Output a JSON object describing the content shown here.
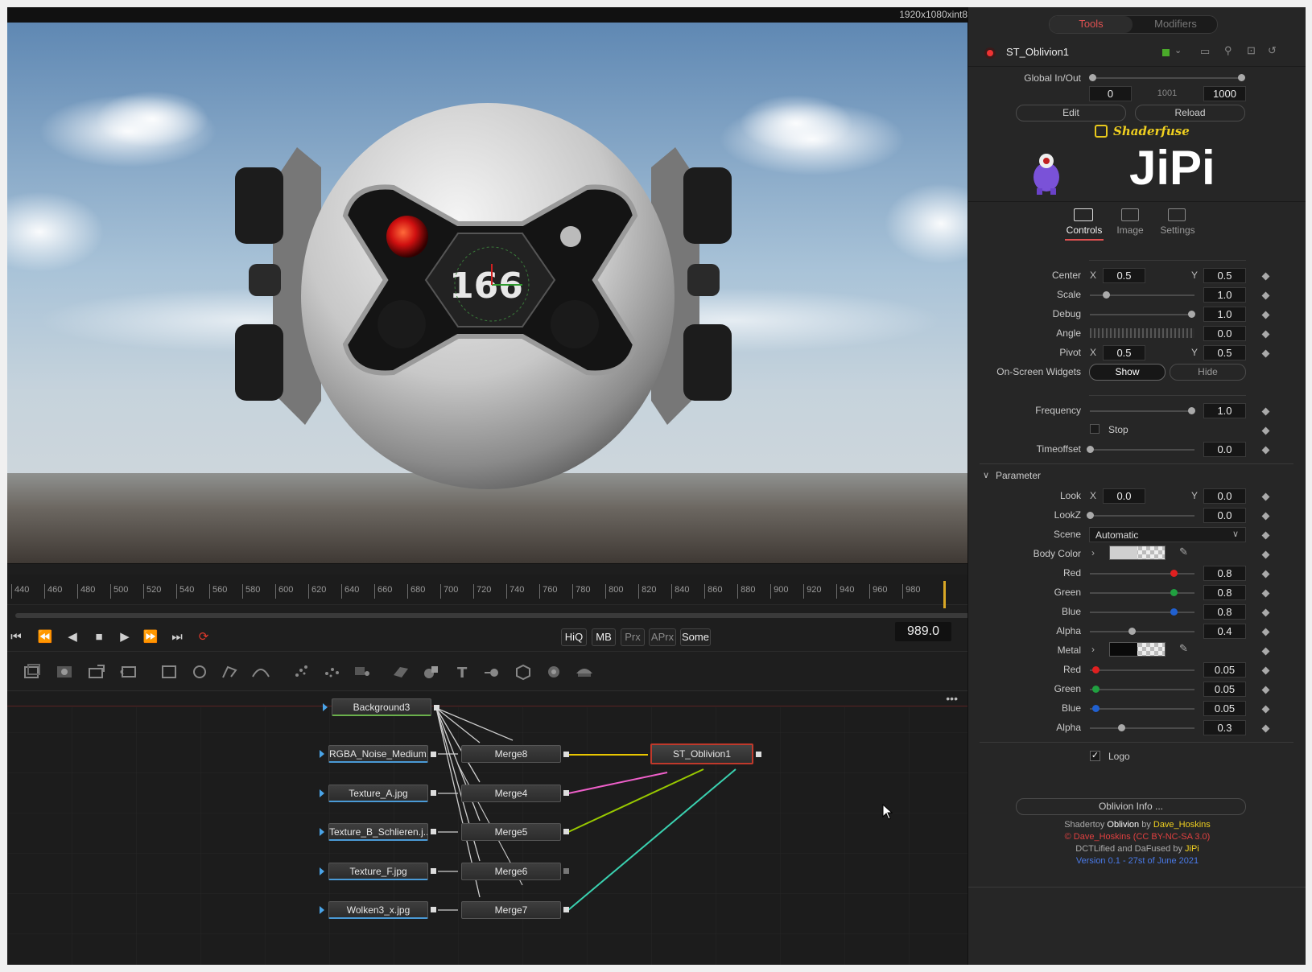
{
  "viewer": {
    "resolution_label": "1920x1080xint8"
  },
  "timeline": {
    "ticks": [
      "440",
      "460",
      "480",
      "500",
      "520",
      "540",
      "560",
      "580",
      "600",
      "620",
      "640",
      "660",
      "680",
      "700",
      "720",
      "740",
      "760",
      "780",
      "800",
      "820",
      "840",
      "860",
      "880",
      "900",
      "920",
      "940",
      "960",
      "980"
    ],
    "current_frame": "989.0"
  },
  "transport": {
    "quality_buttons": [
      "HiQ",
      "MB",
      "Prx",
      "APrx",
      "Some"
    ]
  },
  "flow": {
    "nodes": {
      "background": "Background3",
      "noise": "RGBA_Noise_Medium...",
      "tex_a": "Texture_A.jpg",
      "tex_b": "Texture_B_Schlieren.j...",
      "tex_f": "Texture_F.jpg",
      "wolken": "Wolken3_x.jpg",
      "merge8": "Merge8",
      "merge4": "Merge4",
      "merge5": "Merge5",
      "merge6": "Merge6",
      "merge7": "Merge7",
      "fuse": "ST_Oblivion1"
    },
    "more": "•••"
  },
  "inspector": {
    "tabs": {
      "tools": "Tools",
      "modifiers": "Modifiers"
    },
    "tool_name": "ST_Oblivion1",
    "global_inout_label": "Global In/Out",
    "global_in": "0",
    "global_mid": "1001",
    "global_out": "1000",
    "edit_label": "Edit",
    "reload_label": "Reload",
    "shaderfuse_label": "Shaderfuse",
    "jipi_label": "JiPi",
    "subtabs": {
      "controls": "Controls",
      "image": "Image",
      "settings": "Settings"
    },
    "center": {
      "label": "Center",
      "x_label": "X",
      "x": "0.5",
      "y_label": "Y",
      "y": "0.5"
    },
    "scale": {
      "label": "Scale",
      "value": "1.0",
      "level": 0.15
    },
    "debug": {
      "label": "Debug",
      "value": "1.0",
      "level": 0.97
    },
    "angle": {
      "label": "Angle",
      "value": "0.0"
    },
    "pivot": {
      "label": "Pivot",
      "x_label": "X",
      "x": "0.5",
      "y_label": "Y",
      "y": "0.5"
    },
    "widgets": {
      "label": "On-Screen Widgets",
      "show": "Show",
      "hide": "Hide"
    },
    "frequency": {
      "label": "Frequency",
      "value": "1.0",
      "level": 0.97
    },
    "stop_label": "Stop",
    "timeoffset": {
      "label": "Timeoffset",
      "value": "0.0",
      "level": 0.0
    },
    "parameter_label": "Parameter",
    "look": {
      "label": "Look",
      "x_label": "X",
      "x": "0.0",
      "y_label": "Y",
      "y": "0.0"
    },
    "lookz": {
      "label": "LookZ",
      "value": "0.0",
      "level": 0.0
    },
    "scene": {
      "label": "Scene",
      "value": "Automatic"
    },
    "body_color": {
      "label": "Body Color",
      "red": {
        "label": "Red",
        "value": "0.8",
        "level": 0.8,
        "color": "#e02020"
      },
      "green": {
        "label": "Green",
        "value": "0.8",
        "level": 0.8,
        "color": "#20a040"
      },
      "blue": {
        "label": "Blue",
        "value": "0.8",
        "level": 0.8,
        "color": "#2060d0"
      },
      "alpha": {
        "label": "Alpha",
        "value": "0.4",
        "level": 0.4,
        "color": "#aaaaaa"
      }
    },
    "metal": {
      "label": "Metal",
      "red": {
        "label": "Red",
        "value": "0.05",
        "level": 0.05,
        "color": "#e02020"
      },
      "green": {
        "label": "Green",
        "value": "0.05",
        "level": 0.05,
        "color": "#20a040"
      },
      "blue": {
        "label": "Blue",
        "value": "0.05",
        "level": 0.05,
        "color": "#2060d0"
      },
      "alpha": {
        "label": "Alpha",
        "value": "0.3",
        "level": 0.3,
        "color": "#aaaaaa"
      }
    },
    "logo_label": "Logo",
    "info_button": "Oblivion Info ...",
    "credits": {
      "line1_a": "Shadertoy ",
      "line1_b": "Oblivion",
      "line1_c": " by ",
      "line1_d": "Dave_Hoskins",
      "line2": "© Dave_Hoskins (CC BY-NC-SA 3.0)",
      "line3_a": "DCTLified and DaFused by ",
      "line3_b": "JiPi",
      "line4": "Version 0.1 - 27st of June 2021"
    }
  }
}
